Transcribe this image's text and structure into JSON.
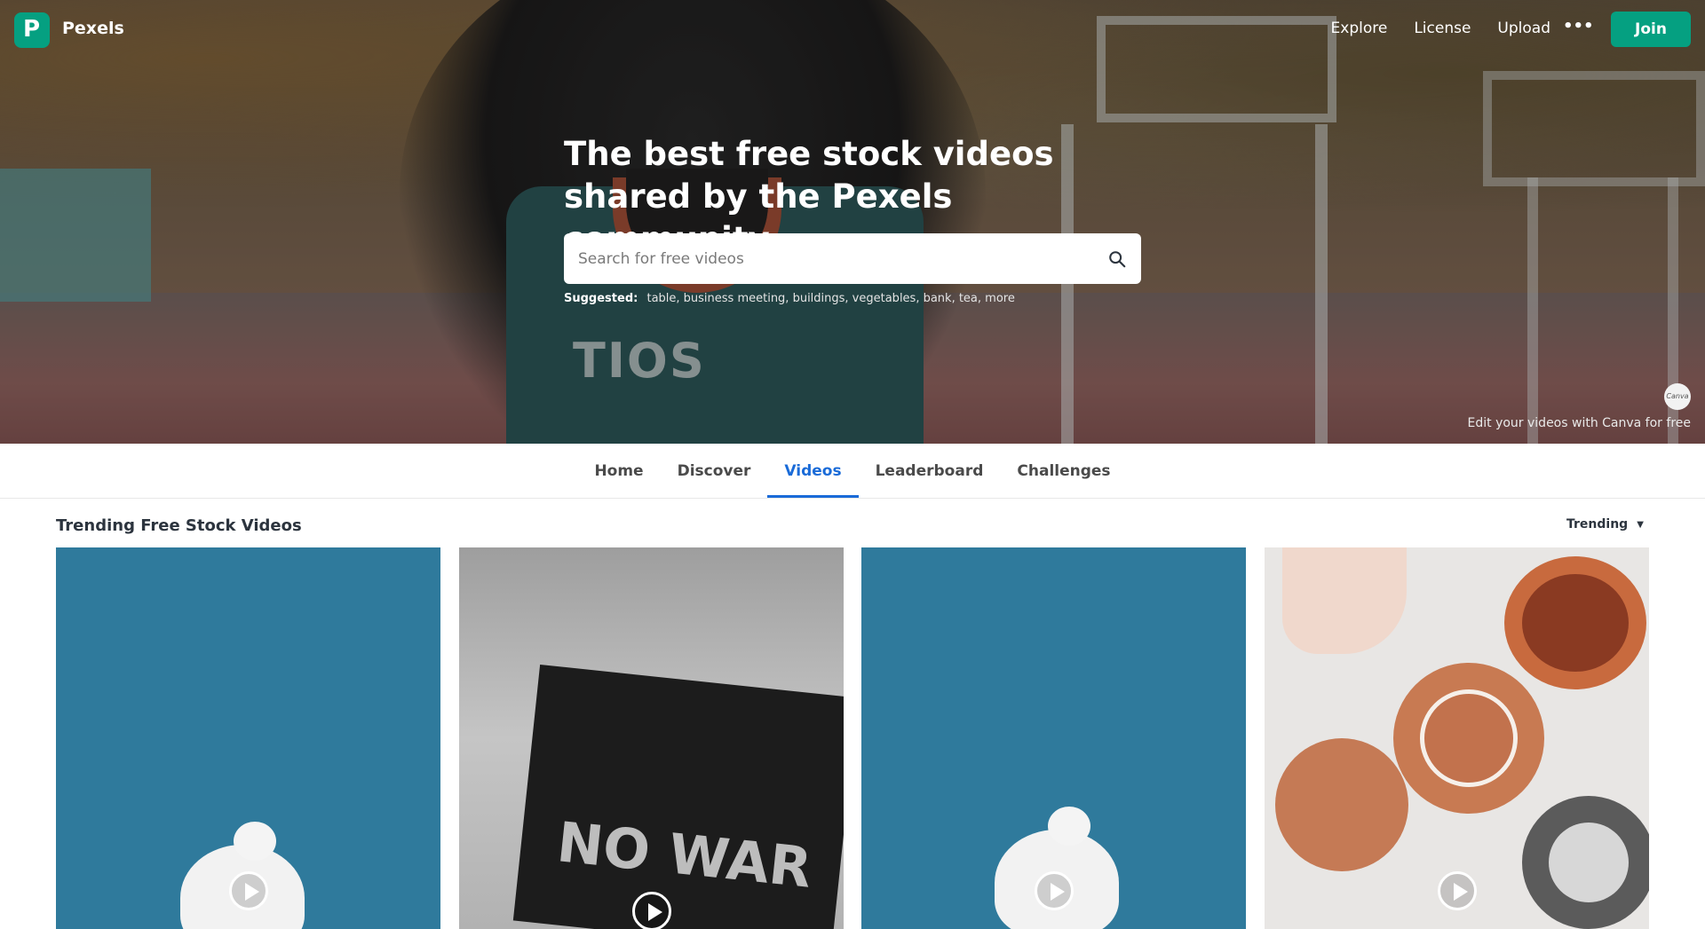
{
  "brand": {
    "name": "Pexels",
    "logo_letter": "P"
  },
  "nav": {
    "links": [
      "Explore",
      "License",
      "Upload"
    ],
    "more_label": "•••",
    "join_label": "Join"
  },
  "hero": {
    "headline": "The best free stock videos shared by the Pexels community.",
    "search_placeholder": "Search for free videos",
    "suggested_label": "Suggested:",
    "suggested_items": "table, business meeting, buildings, vegetables, bank, tea, more",
    "canva_badge": "Canva",
    "canva_text": "Edit your videos with Canva for free",
    "jersey_text": "TIOS"
  },
  "tabs": [
    "Home",
    "Discover",
    "Videos",
    "Leaderboard",
    "Challenges"
  ],
  "active_tab": "Videos",
  "section": {
    "title": "Trending Free Stock Videos",
    "sort_label": "Trending"
  },
  "cards": [
    {
      "subject": "white dove on blue background"
    },
    {
      "subject": "no war sign",
      "sign_text": "NO WAR"
    },
    {
      "subject": "white dove held on blue background"
    },
    {
      "subject": "terracotta teapot and cups"
    }
  ],
  "colors": {
    "brand_green": "#05a081",
    "active_tab": "#1a6bd8",
    "card_blue": "#2f7a9c"
  }
}
